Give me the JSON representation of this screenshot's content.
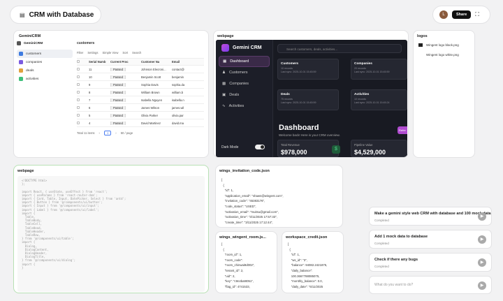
{
  "project": {
    "title": "CRM with Database",
    "icon": "database-icon"
  },
  "account": {
    "avatar": "L",
    "share": "Share"
  },
  "crm_card": {
    "title": "GeminiCRM",
    "brand": "GeminiCRM",
    "nav": [
      "customers",
      "companies",
      "deals",
      "activities"
    ],
    "table_title": "customers",
    "toolbar": [
      "Filter",
      "Settings",
      "Simple View",
      "Sort",
      "Search"
    ],
    "columns": [
      "Serial Numb",
      "Current Proc",
      "Customer Na",
      "Email"
    ],
    "rows": [
      [
        "11",
        "Passed",
        "Johnson Elecroni...",
        "contact@"
      ],
      [
        "10",
        "Passed",
        "Benjamin Scott",
        "benjamin"
      ],
      [
        "9",
        "Passed",
        "Sophia Davis",
        "sophia.da"
      ],
      [
        "8",
        "Passed",
        "William Brown",
        "william.b"
      ],
      [
        "7",
        "Passed",
        "Isabella Nguyen",
        "isabella.n"
      ],
      [
        "6",
        "Passed",
        "James Wilson",
        "james.wil"
      ],
      [
        "5",
        "Passed",
        "Olivia Parker",
        "olivia.par"
      ],
      [
        "4",
        "Passed",
        "David Martinez",
        "david.ma"
      ]
    ],
    "pagination": {
      "total": "Total 11 items",
      "page": "1",
      "per_page": "50 / page"
    }
  },
  "web1": {
    "title": "webpage",
    "app": "Gemini CRM",
    "search": "Search customers, deals, activities...",
    "nav": [
      "Dashboard",
      "Customers",
      "Companies",
      "Deals",
      "Activities"
    ],
    "dark_mode": "Dark Mode",
    "cards": [
      {
        "t": "Customers",
        "c": "10 records",
        "u": "Last sync: 2025-10-01 15:45:59"
      },
      {
        "t": "Companies",
        "c": "20 records",
        "u": "Last sync: 2025-10-01 15:45:59"
      },
      {
        "t": "Deals",
        "c": "75 records",
        "u": "Last sync: 2025-10-01 15:45:59"
      },
      {
        "t": "Activities",
        "c": "10 records",
        "u": "Last sync: 2025-10-01 15:45:24"
      }
    ],
    "heading": "Dashboard",
    "welcome": "Welcome back! Here is your CRM overview.",
    "badge": "Refre",
    "stats": [
      {
        "l": "Total Revenue",
        "v": "$978,000"
      },
      {
        "l": "Pipeline Value",
        "v": "$4,529,000"
      }
    ]
  },
  "logos": {
    "title": "logos",
    "files": [
      "Wingent logo black.png",
      "Wingent logo white.png"
    ]
  },
  "web2": {
    "title": "webpage",
    "code": "<!DOCTYPE html>\n};\n\nimport React, { useState, useEffect } from 'react';\nimport { useParams } from 'react-router-dom';\nimport { Card, Table, Input, DatePicker, Select } from 'antd';\nimport { Button } from '@/components/ui/button';\nimport { Input } from '@/components/ui/input';\nimport { Label } from '@/components/ui/label';\nimport {\n  Table,\n  TableBody,\n  TableCell,\n  TableHead,\n  TableHeader,\n  TableRow,\n} from '@/components/ui/table';\nimport {\n  Dialog,\n  DialogContent,\n  DialogHeader,\n  DialogTitle,\n} from '@/components/ui/dialog';\nimport {\n} "
  },
  "invitation": {
    "title": "wings_invitation_code.json",
    "lines": [
      "[",
      "  {",
      "    \"id\": 1,",
      "    \"application_email\": \"shawn@wingent.com\",",
      "    \"invitation_code\": \"45383176\",",
      "    \"code_status\": \"USED\",",
      "    \"activation_email\": \"muitsu@gmail.com\",",
      "    \"activation_time\": \"3/11/2025 17:57:33\",",
      "    \"create_time\": \"3/11/2025 17:12:44\","
    ]
  },
  "room": {
    "title": "wings_wingent_room.js...",
    "lines": [
      "[",
      "  {",
      "    \"room_id\": 1,",
      "    \"room_code\": ",
      "    \"room_chinwai9d002\",",
      "    \"tenant_id\": 2,",
      "    \"uid\": 2,",
      "    \"key\": \"c9n4ba9t051\",",
      "    \"flag_id\": 4741533,"
    ]
  },
  "credit": {
    "title": "workspace_credit.json",
    "lines": [
      "[",
      "  {",
      "    \"id\": 1,",
      "    \"ws_id\": \"3\",",
      "    \"balance\": 94082.2421875,",
      "    \"daily_balance\": ",
      "    100.3667788085075,",
      "    \"monthly_balance\": 0.0,",
      "    \"daily_date\": \"6/11/2025"
    ]
  },
  "tasks": [
    {
      "title": "Make a gemini style web CRM with database and 100 mock data",
      "status": "Completed"
    },
    {
      "title": "Add 1 mock data to database",
      "status": "Completed"
    },
    {
      "title": "Check if there any bugs",
      "status": "Completed"
    }
  ],
  "chat": {
    "placeholder": "What do you want to do?"
  }
}
